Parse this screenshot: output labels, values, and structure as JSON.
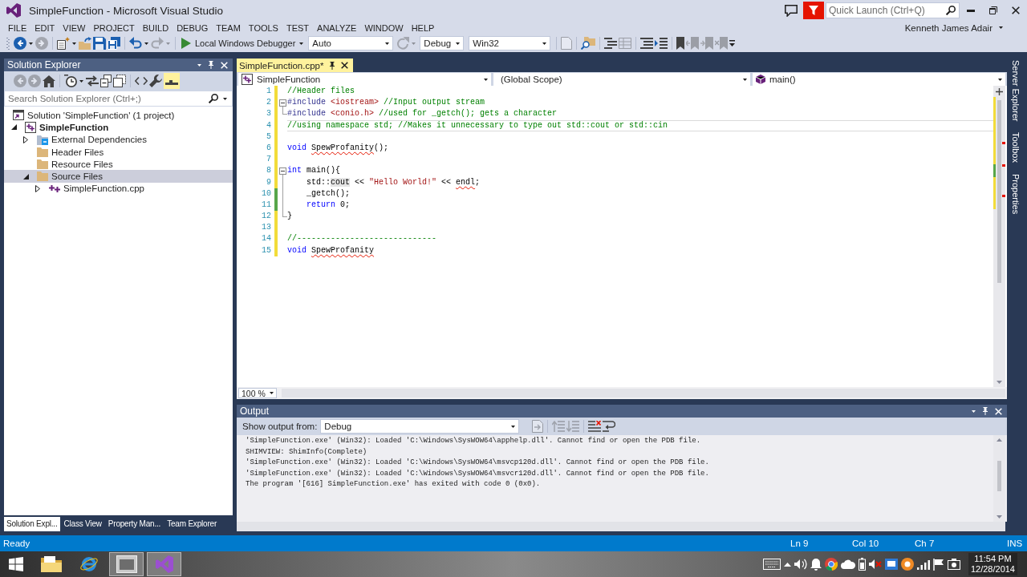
{
  "window": {
    "title": "SimpleFunction - Microsoft Visual Studio"
  },
  "quick_launch": {
    "placeholder": "Quick Launch (Ctrl+Q)"
  },
  "menu": [
    "FILE",
    "EDIT",
    "VIEW",
    "PROJECT",
    "BUILD",
    "DEBUG",
    "TEAM",
    "TOOLS",
    "TEST",
    "ANALYZE",
    "WINDOW",
    "HELP"
  ],
  "account": "Kenneth James Adair",
  "toolbar": [
    {
      "kind": "back",
      "disabled": false
    },
    {
      "kind": "caret",
      "disabled": false
    },
    {
      "kind": "forward",
      "disabled": true
    },
    {
      "kind": "separator"
    },
    {
      "kind": "new-project",
      "disabled": false
    },
    {
      "kind": "caret",
      "disabled": false
    },
    {
      "kind": "open",
      "disabled": false
    },
    {
      "kind": "save",
      "disabled": false
    },
    {
      "kind": "save-all",
      "disabled": false
    },
    {
      "kind": "separator"
    },
    {
      "kind": "undo",
      "disabled": false
    },
    {
      "kind": "caret",
      "disabled": false
    },
    {
      "kind": "redo",
      "disabled": true
    },
    {
      "kind": "caret",
      "disabled": true
    },
    {
      "kind": "separator"
    },
    {
      "kind": "run",
      "label": "Local Windows Debugger",
      "disabled": false
    },
    {
      "kind": "combo",
      "value": "Auto"
    },
    {
      "kind": "refresh",
      "disabled": true
    },
    {
      "kind": "caret",
      "disabled": true
    },
    {
      "kind": "combo",
      "value": "Debug"
    },
    {
      "kind": "combo",
      "value": "Win32"
    },
    {
      "kind": "separator"
    },
    {
      "kind": "document",
      "disabled": true
    },
    {
      "kind": "separator"
    },
    {
      "kind": "find-in-files",
      "disabled": false
    },
    {
      "kind": "separator"
    },
    {
      "kind": "tree-lines",
      "disabled": false
    },
    {
      "kind": "grid",
      "disabled": true
    },
    {
      "kind": "separator"
    },
    {
      "kind": "comment",
      "disabled": false
    },
    {
      "kind": "uncomment",
      "disabled": false
    },
    {
      "kind": "separator"
    },
    {
      "kind": "bookmark",
      "disabled": false
    },
    {
      "kind": "bookmark-prev",
      "disabled": true
    },
    {
      "kind": "bookmark-next",
      "disabled": true
    },
    {
      "kind": "bookmark-clear",
      "disabled": true
    },
    {
      "kind": "overflow",
      "disabled": false
    }
  ],
  "solution_explorer": {
    "title": "Solution Explorer",
    "toolbar": [
      {
        "kind": "back",
        "disabled": true
      },
      {
        "kind": "forward",
        "disabled": true
      },
      {
        "kind": "home",
        "disabled": false
      },
      {
        "kind": "separator"
      },
      {
        "kind": "history",
        "disabled": false
      },
      {
        "kind": "caret",
        "disabled": false
      },
      {
        "kind": "sync",
        "disabled": false
      },
      {
        "kind": "collapse",
        "disabled": false
      },
      {
        "kind": "show-all",
        "disabled": false
      },
      {
        "kind": "separator"
      },
      {
        "kind": "code",
        "disabled": false
      },
      {
        "kind": "properties",
        "disabled": false
      },
      {
        "kind": "preview",
        "disabled": false,
        "on": true
      }
    ],
    "search": {
      "placeholder": "Search Solution Explorer (Ctrl+;)"
    },
    "tree": [
      {
        "label": "Solution 'SimpleFunction' (1 project)",
        "kind": "solution",
        "selected": false,
        "children": [
          {
            "label": "SimpleFunction",
            "kind": "project",
            "selected": false,
            "expanded": true,
            "children": [
              {
                "label": "External Dependencies",
                "kind": "references",
                "selected": false,
                "expanded": false
              },
              {
                "label": "Header Files",
                "kind": "filter",
                "selected": false
              },
              {
                "label": "Resource Files",
                "kind": "filter",
                "selected": false
              },
              {
                "label": "Source Files",
                "kind": "filter",
                "selected": true,
                "expanded": true,
                "children": [
                  {
                    "label": "SimpleFunction.cpp",
                    "kind": "cpp",
                    "selected": false,
                    "expanded": false
                  }
                ]
              }
            ]
          }
        ]
      }
    ],
    "tabs": [
      {
        "label": "Solution Expl...",
        "selected": true
      },
      {
        "label": "Class View",
        "selected": false
      },
      {
        "label": "Property Man...",
        "selected": false
      },
      {
        "label": "Team Explorer",
        "selected": false
      }
    ]
  },
  "editor": {
    "tab": {
      "label": "SimpleFunction.cpp*",
      "selected": true
    },
    "navigation": [
      {
        "kind": "project",
        "value": "SimpleFunction"
      },
      {
        "kind": "scope",
        "value": "(Global Scope)"
      },
      {
        "kind": "member",
        "value": "main()"
      }
    ],
    "lines": [
      {
        "number": "1",
        "saved": false,
        "highlighted": false,
        "tokens": [
          {
            "kind": "comment",
            "text": "//Header files"
          }
        ]
      },
      {
        "number": "2",
        "saved": false,
        "highlighted": false,
        "fold_start": true,
        "expanded": true,
        "tokens": [
          {
            "kind": "preproc",
            "text": "#include"
          },
          {
            "kind": "include",
            "text": " <iostream>"
          },
          {
            "kind": "comment",
            "text": " //Input output stream"
          }
        ]
      },
      {
        "number": "3",
        "saved": false,
        "highlighted": false,
        "fold_end": true,
        "tokens": [
          {
            "kind": "preproc",
            "text": "#include"
          },
          {
            "kind": "include",
            "text": " <conio.h>"
          },
          {
            "kind": "comment",
            "text": " //used for _getch(); gets a character"
          }
        ]
      },
      {
        "number": "4",
        "saved": false,
        "highlighted": true,
        "tokens": [
          {
            "kind": "comment",
            "text": "//using namespace std; //Makes it unnecessary to type out std::cout or std::cin"
          }
        ]
      },
      {
        "number": "5",
        "saved": false,
        "highlighted": false
      },
      {
        "number": "6",
        "saved": false,
        "highlighted": false,
        "tokens": [
          {
            "kind": "keyword",
            "text": "void "
          },
          {
            "kind": "error",
            "text": "SpewProfanity"
          },
          {
            "kind": "plain",
            "text": "();"
          }
        ]
      },
      {
        "number": "7",
        "saved": false,
        "highlighted": false
      },
      {
        "number": "8",
        "saved": false,
        "highlighted": false,
        "fold_start": true,
        "expanded": true,
        "tokens": [
          {
            "kind": "keyword",
            "text": "int"
          },
          {
            "kind": "plain",
            "text": " main(){"
          }
        ]
      },
      {
        "number": "9",
        "saved": false,
        "highlighted": false,
        "tokens": [
          {
            "kind": "plain",
            "text": "    std::"
          },
          {
            "kind": "reference",
            "text": "cout"
          },
          {
            "kind": "plain",
            "text": " << "
          },
          {
            "kind": "string",
            "text": "\"Hello World!\""
          },
          {
            "kind": "plain",
            "text": " << "
          },
          {
            "kind": "error",
            "text": "endl"
          },
          {
            "kind": "plain",
            "text": ";"
          }
        ]
      },
      {
        "number": "10",
        "saved": true,
        "highlighted": false,
        "tokens": [
          {
            "kind": "plain",
            "text": "    _getch();"
          }
        ]
      },
      {
        "number": "11",
        "saved": true,
        "highlighted": false,
        "tokens": [
          {
            "kind": "keyword",
            "text": "    return"
          },
          {
            "kind": "plain",
            "text": " 0;"
          }
        ]
      },
      {
        "number": "12",
        "saved": false,
        "highlighted": false,
        "fold_end": true,
        "tokens": [
          {
            "kind": "plain",
            "text": "}"
          }
        ]
      },
      {
        "number": "13",
        "saved": false,
        "highlighted": false
      },
      {
        "number": "14",
        "saved": false,
        "highlighted": false,
        "tokens": [
          {
            "kind": "comment",
            "text": "//-----------------------------"
          }
        ]
      },
      {
        "number": "15",
        "saved": false,
        "highlighted": false,
        "tokens": [
          {
            "kind": "keyword",
            "text": "void "
          },
          {
            "kind": "error",
            "text": "SpewProfanity"
          }
        ]
      }
    ],
    "zoom": "100 %"
  },
  "output": {
    "title": "Output",
    "source_label": "Show output from:",
    "source": "Debug",
    "toolbar": [
      {
        "kind": "find-message",
        "disabled": true
      },
      {
        "kind": "separator"
      },
      {
        "kind": "prev-message",
        "disabled": true
      },
      {
        "kind": "next-message",
        "disabled": true
      },
      {
        "kind": "separator"
      },
      {
        "kind": "clear-all",
        "disabled": false
      },
      {
        "kind": "word-wrap",
        "disabled": false
      }
    ],
    "lines": [
      "'SimpleFunction.exe' (Win32): Loaded 'C:\\Windows\\SysWOW64\\apphelp.dll'. Cannot find or open the PDB file.",
      "SHIMVIEW: ShimInfo(Complete)",
      "'SimpleFunction.exe' (Win32): Loaded 'C:\\Windows\\SysWOW64\\msvcp120d.dll'. Cannot find or open the PDB file.",
      "'SimpleFunction.exe' (Win32): Loaded 'C:\\Windows\\SysWOW64\\msvcr120d.dll'. Cannot find or open the PDB file.",
      "The program '[616] SimpleFunction.exe' has exited with code 0 (0x0)."
    ]
  },
  "side_tabs": [
    "Server Explorer",
    "Toolbox",
    "Properties"
  ],
  "status_bar": {
    "message": "Ready",
    "line": "Ln 9",
    "column": "Col 10",
    "char": "Ch 7",
    "mode": "INS"
  },
  "taskbar": {
    "apps": [
      {
        "kind": "file-explorer",
        "running": false
      },
      {
        "kind": "internet-explorer",
        "running": false
      },
      {
        "kind": "media-app",
        "running": true
      },
      {
        "kind": "visual-studio",
        "running": true
      }
    ],
    "time": "11:54 PM",
    "date": "12/28/2014"
  }
}
